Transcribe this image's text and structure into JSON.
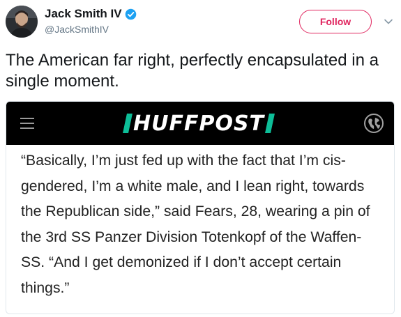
{
  "tweet": {
    "author": {
      "display_name": "Jack Smith IV",
      "handle": "@JackSmithIV",
      "verified": true,
      "avatar_icon": "person-avatar"
    },
    "follow_label": "Follow",
    "text": "The American far right, perfectly encapsulated in a single moment."
  },
  "media": {
    "brand": "HUFFPOST",
    "brand_accent_color": "#0dbe98",
    "quote": "“Basically, I’m just fed up with the fact that I’m cis-gendered, I’m a white male, and I lean right, towards the Republican side,” said Fears, 28, wearing a pin of the 3rd SS Panzer Division Totenkopf of the Waffen-SS. “And I get demonized if I don’t accept certain things.”"
  },
  "colors": {
    "follow": "#e0245e",
    "verified": "#1da1f2",
    "handle": "#657786",
    "text": "#14171a"
  }
}
